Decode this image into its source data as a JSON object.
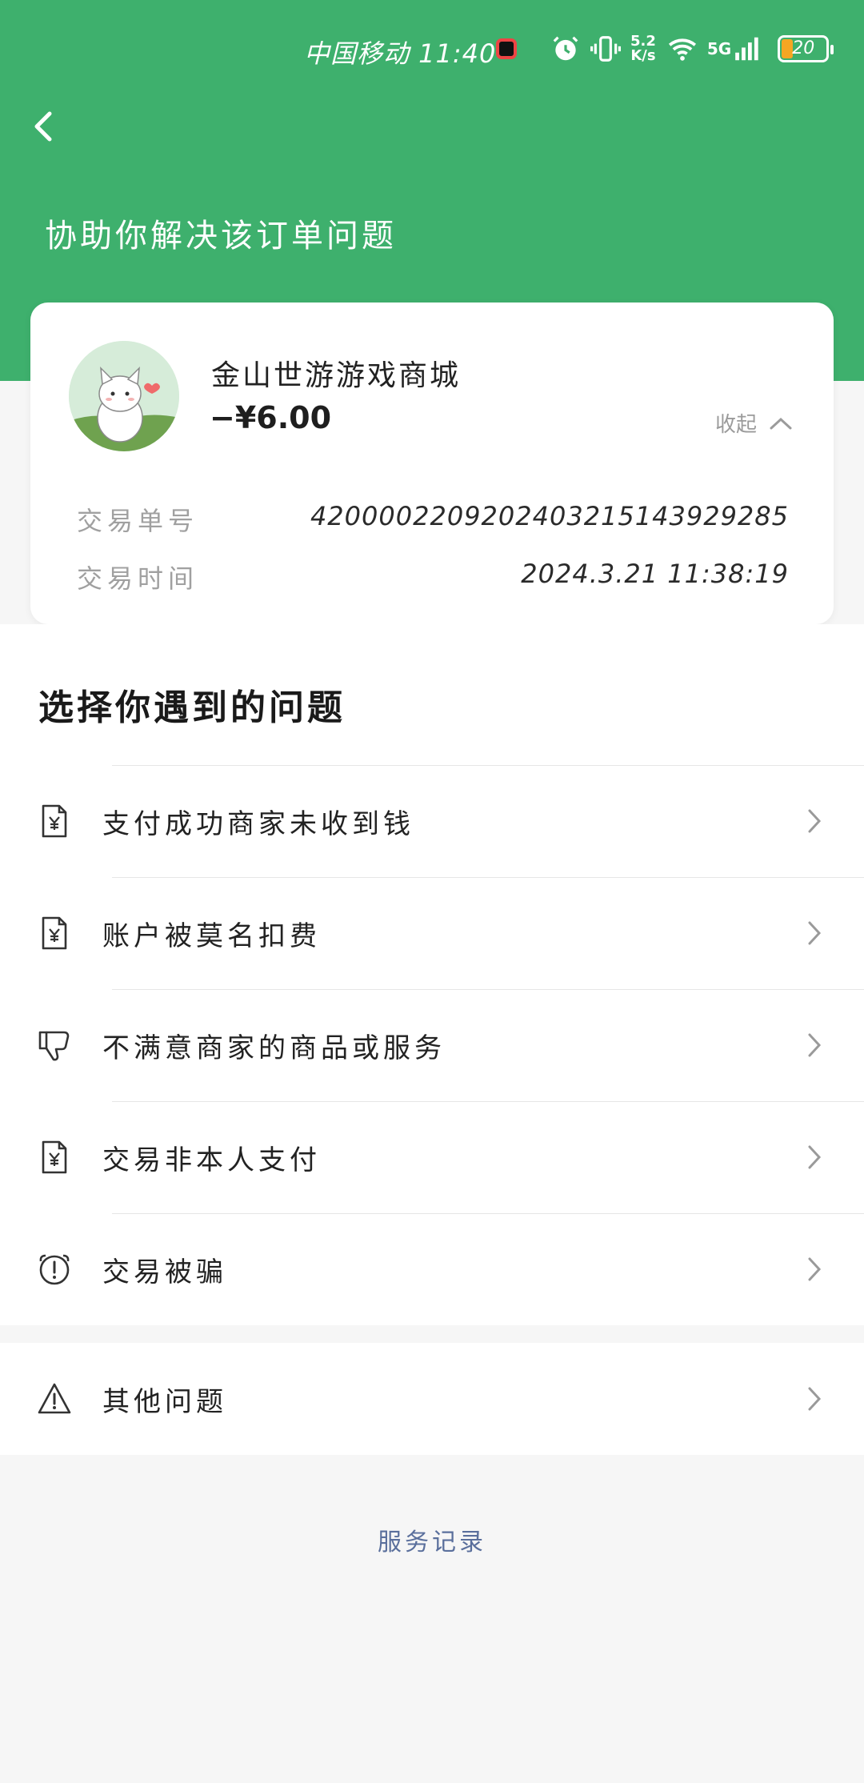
{
  "status_bar": {
    "carrier_time": "中国移动 11:40",
    "net_speed_top": "5.2",
    "net_speed_bottom": "K/s",
    "network": "5G",
    "battery": "20"
  },
  "header": {
    "title": "协助你解决该订单问题",
    "color": "#3eb06d"
  },
  "order_card": {
    "merchant": "金山世游游戏商城",
    "amount": "−¥6.00",
    "collapse_label": "收起",
    "rows": [
      {
        "key": "交易单号",
        "value": "4200002209202403215143929285"
      },
      {
        "key": "交易时间",
        "value": "2024.3.21  11:38:19"
      }
    ]
  },
  "section_title": "选择你遇到的问题",
  "problems": [
    {
      "label": "支付成功商家未收到钱",
      "icon": "yuan-document-icon"
    },
    {
      "label": "账户被莫名扣费",
      "icon": "yuan-document-icon"
    },
    {
      "label": "不满意商家的商品或服务",
      "icon": "thumbs-down-icon"
    },
    {
      "label": "交易非本人支付",
      "icon": "yuan-document-icon"
    },
    {
      "label": "交易被骗",
      "icon": "alarm-clock-icon"
    }
  ],
  "other_problem": {
    "label": "其他问题",
    "icon": "warning-icon"
  },
  "service_record": "服务记录"
}
